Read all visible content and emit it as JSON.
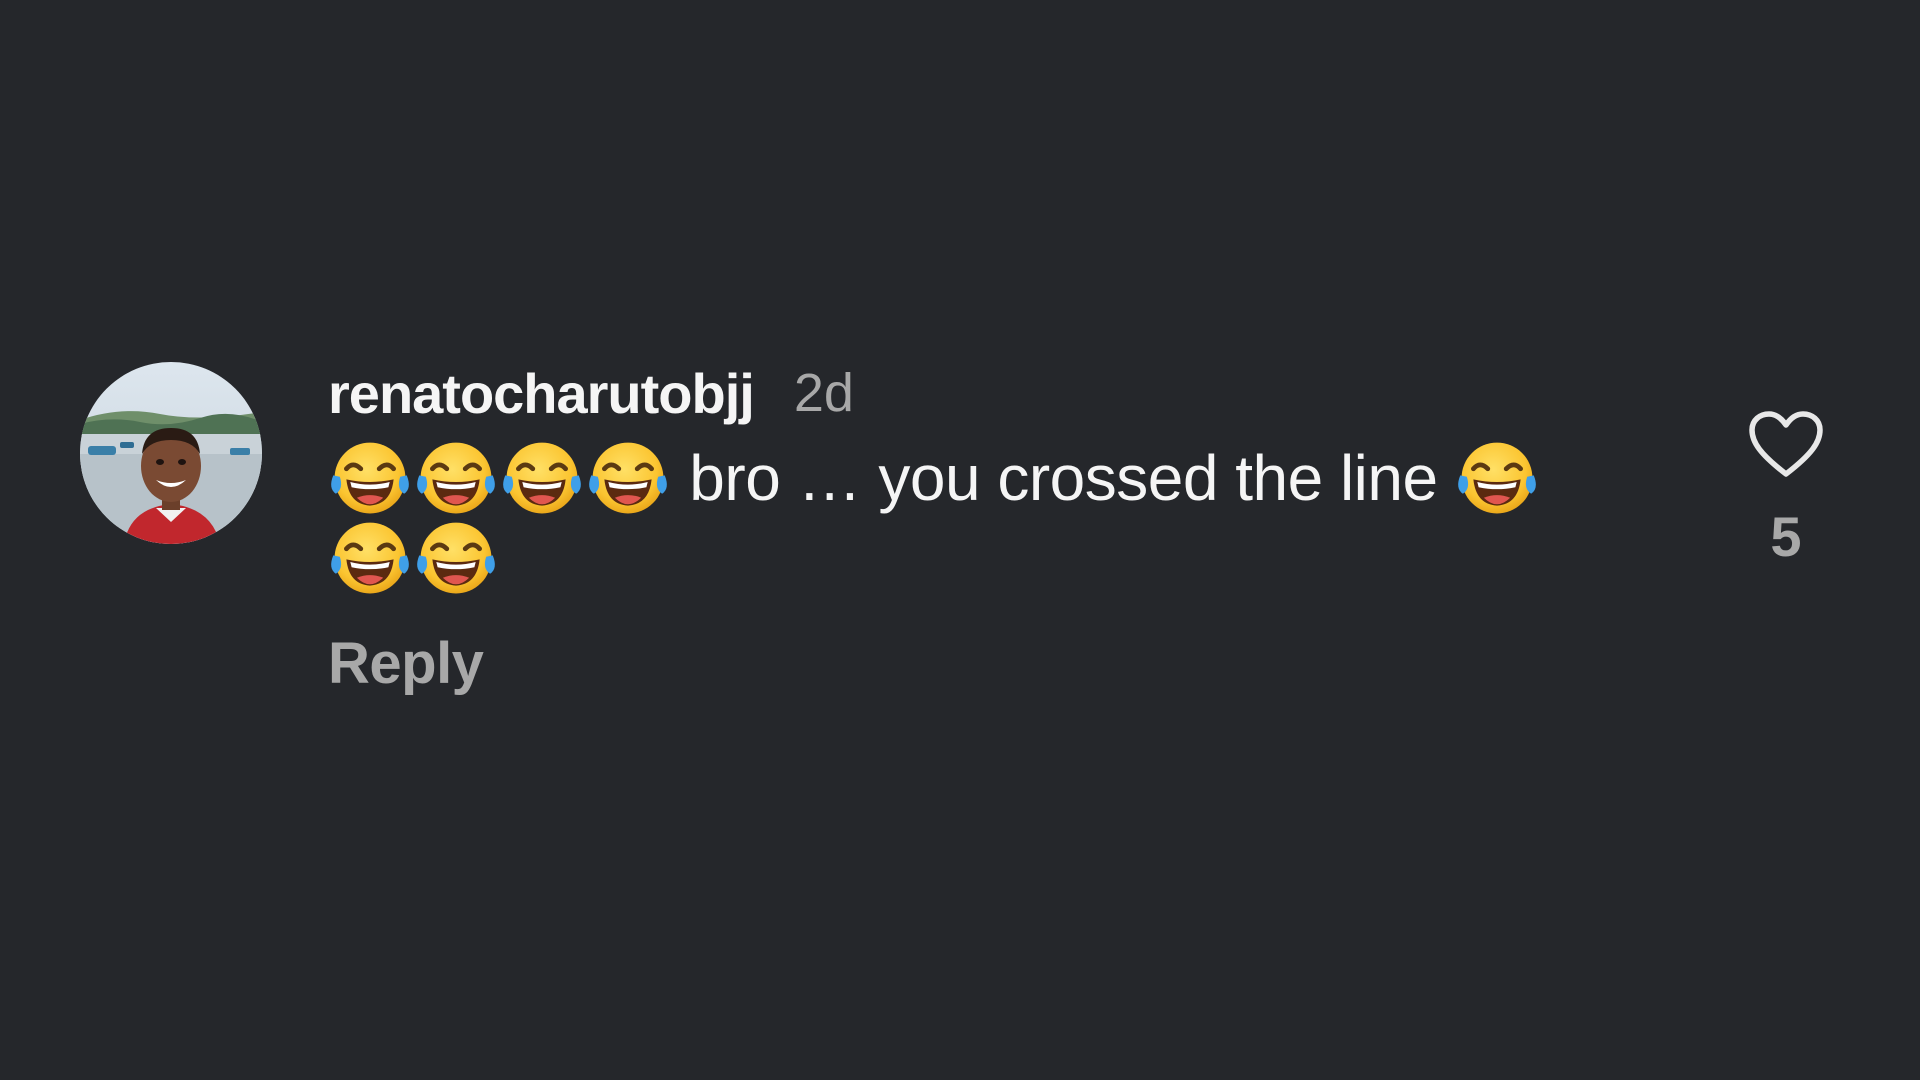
{
  "comment": {
    "username": "renatocharutobjj",
    "time_ago": "2d",
    "emoji_icon": "face-with-tears-of-joy-icon",
    "text": "bro … you crossed the line",
    "leading_emoji_count": 4,
    "trailing_emoji_count": 3,
    "reply_label": "Reply",
    "like_count": "5",
    "like_icon": "heart-outline-icon"
  },
  "colors": {
    "background": "#25272b",
    "primary_text": "#f5f5f5",
    "secondary_text": "#a8a8a8"
  }
}
